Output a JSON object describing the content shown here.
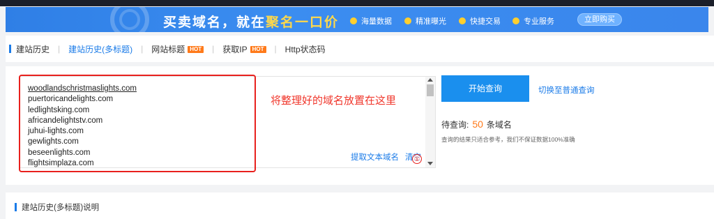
{
  "banner": {
    "slogan_prefix": "买卖域名，就在",
    "slogan_highlight": "聚名一口价",
    "features": [
      "海量数据",
      "精准曝光",
      "快捷交易",
      "专业服务"
    ],
    "buy_button": "立即购买"
  },
  "tabs": [
    {
      "label": "建站历史",
      "active": false
    },
    {
      "label": "建站历史(多标题)",
      "active": true
    },
    {
      "label": "网站标题",
      "badge": "HOT"
    },
    {
      "label": "获取IP",
      "badge": "HOT"
    },
    {
      "label": "Http状态码"
    }
  ],
  "query": {
    "domains": [
      "woodlandschristmaslights.com",
      "puertoricandelights.com",
      "ledlightsking.com",
      "africandelightstv.com",
      "juhui-lights.com",
      "gewlights.com",
      "beseenlights.com",
      "flightsimplaza.com"
    ],
    "annotation_hint": "将整理好的域名放置在这里",
    "extract_link": "提取文本域名",
    "clear_link": "清空",
    "marker": "①",
    "start_button": "开始查询",
    "switch_link": "切换至普通查询",
    "pending_label": "待查询:",
    "pending_count": "50",
    "pending_unit": "条域名",
    "disclaimer": "查询的结果只适合参考，我们不保证数据100%准确"
  },
  "description": {
    "title": "建站历史(多标题)说明"
  },
  "colors": {
    "accent": "#1a7be8",
    "annotation_red": "#e8201d",
    "hot_badge": "#ff7a1a",
    "button_blue": "#1a8fee"
  }
}
